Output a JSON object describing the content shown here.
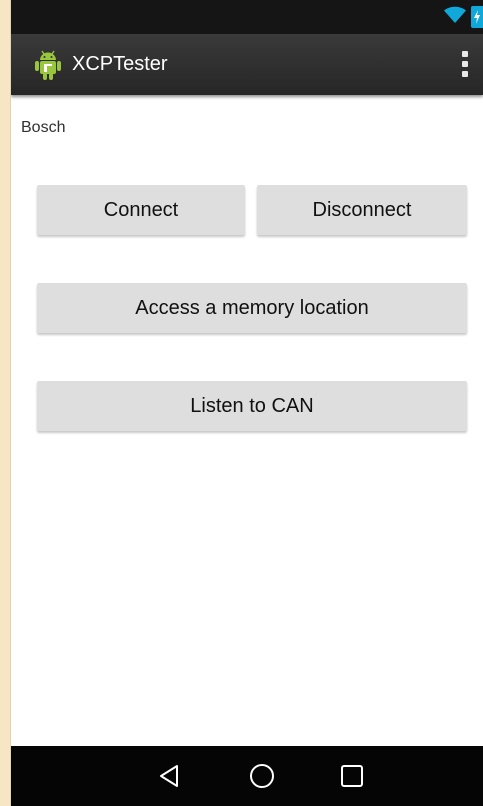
{
  "app_bar": {
    "title": "XCPTester"
  },
  "main": {
    "subtitle": "Bosch",
    "buttons": {
      "connect": "Connect",
      "disconnect": "Disconnect",
      "access_memory": "Access a memory location",
      "listen_can": "Listen to CAN"
    }
  },
  "icons": {
    "wifi": "wifi-icon",
    "battery": "battery-charging-icon",
    "app": "android-app-icon",
    "overflow": "overflow-menu-icon",
    "back": "back-icon",
    "home": "home-icon",
    "recents": "recents-icon"
  },
  "colors": {
    "status_bar": "#151515",
    "app_bar": "#2f2f2f",
    "button_bg": "#dedede",
    "accent": "#0fa8d8",
    "nav_bar": "#050505",
    "outer_bg": "#f7e6c3",
    "app_icon": "#98c63c"
  }
}
